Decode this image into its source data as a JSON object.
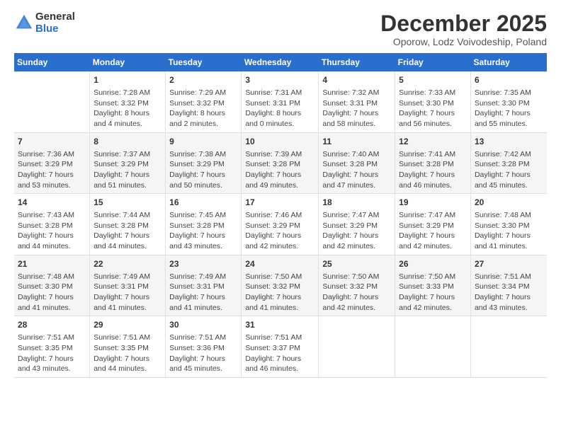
{
  "header": {
    "logo_general": "General",
    "logo_blue": "Blue",
    "month_title": "December 2025",
    "location": "Oporow, Lodz Voivodeship, Poland"
  },
  "days_of_week": [
    "Sunday",
    "Monday",
    "Tuesday",
    "Wednesday",
    "Thursday",
    "Friday",
    "Saturday"
  ],
  "weeks": [
    [
      {
        "day": "",
        "sunrise": "",
        "sunset": "",
        "daylight": ""
      },
      {
        "day": "1",
        "sunrise": "Sunrise: 7:28 AM",
        "sunset": "Sunset: 3:32 PM",
        "daylight": "Daylight: 8 hours and 4 minutes."
      },
      {
        "day": "2",
        "sunrise": "Sunrise: 7:29 AM",
        "sunset": "Sunset: 3:32 PM",
        "daylight": "Daylight: 8 hours and 2 minutes."
      },
      {
        "day": "3",
        "sunrise": "Sunrise: 7:31 AM",
        "sunset": "Sunset: 3:31 PM",
        "daylight": "Daylight: 8 hours and 0 minutes."
      },
      {
        "day": "4",
        "sunrise": "Sunrise: 7:32 AM",
        "sunset": "Sunset: 3:31 PM",
        "daylight": "Daylight: 7 hours and 58 minutes."
      },
      {
        "day": "5",
        "sunrise": "Sunrise: 7:33 AM",
        "sunset": "Sunset: 3:30 PM",
        "daylight": "Daylight: 7 hours and 56 minutes."
      },
      {
        "day": "6",
        "sunrise": "Sunrise: 7:35 AM",
        "sunset": "Sunset: 3:30 PM",
        "daylight": "Daylight: 7 hours and 55 minutes."
      }
    ],
    [
      {
        "day": "7",
        "sunrise": "Sunrise: 7:36 AM",
        "sunset": "Sunset: 3:29 PM",
        "daylight": "Daylight: 7 hours and 53 minutes."
      },
      {
        "day": "8",
        "sunrise": "Sunrise: 7:37 AM",
        "sunset": "Sunset: 3:29 PM",
        "daylight": "Daylight: 7 hours and 51 minutes."
      },
      {
        "day": "9",
        "sunrise": "Sunrise: 7:38 AM",
        "sunset": "Sunset: 3:29 PM",
        "daylight": "Daylight: 7 hours and 50 minutes."
      },
      {
        "day": "10",
        "sunrise": "Sunrise: 7:39 AM",
        "sunset": "Sunset: 3:28 PM",
        "daylight": "Daylight: 7 hours and 49 minutes."
      },
      {
        "day": "11",
        "sunrise": "Sunrise: 7:40 AM",
        "sunset": "Sunset: 3:28 PM",
        "daylight": "Daylight: 7 hours and 47 minutes."
      },
      {
        "day": "12",
        "sunrise": "Sunrise: 7:41 AM",
        "sunset": "Sunset: 3:28 PM",
        "daylight": "Daylight: 7 hours and 46 minutes."
      },
      {
        "day": "13",
        "sunrise": "Sunrise: 7:42 AM",
        "sunset": "Sunset: 3:28 PM",
        "daylight": "Daylight: 7 hours and 45 minutes."
      }
    ],
    [
      {
        "day": "14",
        "sunrise": "Sunrise: 7:43 AM",
        "sunset": "Sunset: 3:28 PM",
        "daylight": "Daylight: 7 hours and 44 minutes."
      },
      {
        "day": "15",
        "sunrise": "Sunrise: 7:44 AM",
        "sunset": "Sunset: 3:28 PM",
        "daylight": "Daylight: 7 hours and 44 minutes."
      },
      {
        "day": "16",
        "sunrise": "Sunrise: 7:45 AM",
        "sunset": "Sunset: 3:28 PM",
        "daylight": "Daylight: 7 hours and 43 minutes."
      },
      {
        "day": "17",
        "sunrise": "Sunrise: 7:46 AM",
        "sunset": "Sunset: 3:29 PM",
        "daylight": "Daylight: 7 hours and 42 minutes."
      },
      {
        "day": "18",
        "sunrise": "Sunrise: 7:47 AM",
        "sunset": "Sunset: 3:29 PM",
        "daylight": "Daylight: 7 hours and 42 minutes."
      },
      {
        "day": "19",
        "sunrise": "Sunrise: 7:47 AM",
        "sunset": "Sunset: 3:29 PM",
        "daylight": "Daylight: 7 hours and 42 minutes."
      },
      {
        "day": "20",
        "sunrise": "Sunrise: 7:48 AM",
        "sunset": "Sunset: 3:30 PM",
        "daylight": "Daylight: 7 hours and 41 minutes."
      }
    ],
    [
      {
        "day": "21",
        "sunrise": "Sunrise: 7:48 AM",
        "sunset": "Sunset: 3:30 PM",
        "daylight": "Daylight: 7 hours and 41 minutes."
      },
      {
        "day": "22",
        "sunrise": "Sunrise: 7:49 AM",
        "sunset": "Sunset: 3:31 PM",
        "daylight": "Daylight: 7 hours and 41 minutes."
      },
      {
        "day": "23",
        "sunrise": "Sunrise: 7:49 AM",
        "sunset": "Sunset: 3:31 PM",
        "daylight": "Daylight: 7 hours and 41 minutes."
      },
      {
        "day": "24",
        "sunrise": "Sunrise: 7:50 AM",
        "sunset": "Sunset: 3:32 PM",
        "daylight": "Daylight: 7 hours and 41 minutes."
      },
      {
        "day": "25",
        "sunrise": "Sunrise: 7:50 AM",
        "sunset": "Sunset: 3:32 PM",
        "daylight": "Daylight: 7 hours and 42 minutes."
      },
      {
        "day": "26",
        "sunrise": "Sunrise: 7:50 AM",
        "sunset": "Sunset: 3:33 PM",
        "daylight": "Daylight: 7 hours and 42 minutes."
      },
      {
        "day": "27",
        "sunrise": "Sunrise: 7:51 AM",
        "sunset": "Sunset: 3:34 PM",
        "daylight": "Daylight: 7 hours and 43 minutes."
      }
    ],
    [
      {
        "day": "28",
        "sunrise": "Sunrise: 7:51 AM",
        "sunset": "Sunset: 3:35 PM",
        "daylight": "Daylight: 7 hours and 43 minutes."
      },
      {
        "day": "29",
        "sunrise": "Sunrise: 7:51 AM",
        "sunset": "Sunset: 3:35 PM",
        "daylight": "Daylight: 7 hours and 44 minutes."
      },
      {
        "day": "30",
        "sunrise": "Sunrise: 7:51 AM",
        "sunset": "Sunset: 3:36 PM",
        "daylight": "Daylight: 7 hours and 45 minutes."
      },
      {
        "day": "31",
        "sunrise": "Sunrise: 7:51 AM",
        "sunset": "Sunset: 3:37 PM",
        "daylight": "Daylight: 7 hours and 46 minutes."
      },
      {
        "day": "",
        "sunrise": "",
        "sunset": "",
        "daylight": ""
      },
      {
        "day": "",
        "sunrise": "",
        "sunset": "",
        "daylight": ""
      },
      {
        "day": "",
        "sunrise": "",
        "sunset": "",
        "daylight": ""
      }
    ]
  ]
}
